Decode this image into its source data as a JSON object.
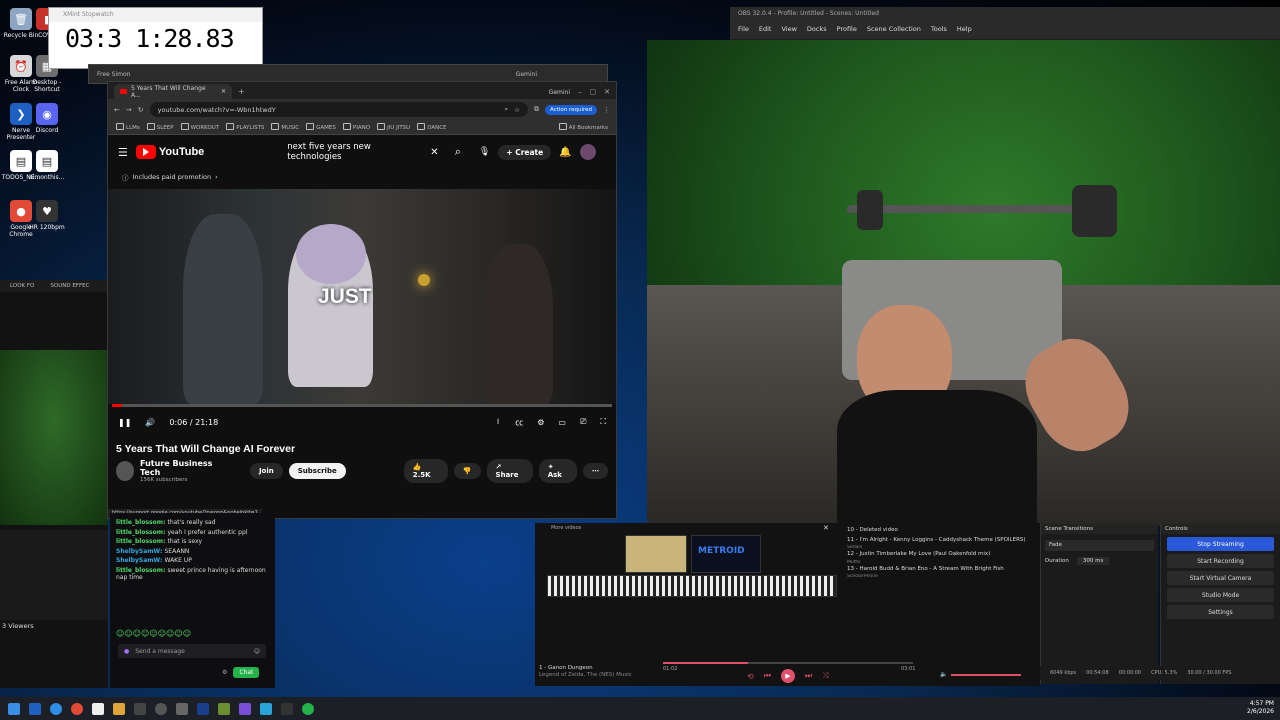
{
  "desktop": {
    "icons": [
      {
        "label": "Recycle Bin",
        "color": "#8da6c4",
        "glyph": "🗑"
      },
      {
        "label": "Free Alarm Clock",
        "color": "#d9d9d9",
        "glyph": "⏰"
      },
      {
        "label": "Nerve Presenter",
        "color": "#1e5fc2",
        "glyph": "❯"
      },
      {
        "label": "TODOS_NE...",
        "color": "#ffffff",
        "glyph": "▤"
      },
      {
        "label": "Google Chrome",
        "color": "#e04a36",
        "glyph": "●"
      },
      {
        "label": "COV...",
        "color": "#c8302a",
        "glyph": "▮"
      },
      {
        "label": "Desktop - Shortcut",
        "color": "#6e6e6e",
        "glyph": "▦"
      },
      {
        "label": "Discord",
        "color": "#5865f2",
        "glyph": "◉"
      },
      {
        "label": "simonthis...",
        "color": "#ffffff",
        "glyph": "▤"
      },
      {
        "label": "HR 120bpm",
        "color": "#333333",
        "glyph": "♥"
      }
    ]
  },
  "stopwatch": {
    "title": "XMint Stopwatch",
    "display": "03:3 1:28.83"
  },
  "chrome_back": {
    "tab": "Free Simon",
    "gemini": "Gemini"
  },
  "chrome": {
    "tab_title": "5 Years That Will Change A...",
    "gemini": "Gemini",
    "url": "youtube.com/watch?v=-Wbn1htwdY",
    "action_required": "Action required",
    "bookmarks": [
      "LLMs",
      "SLEEP",
      "WORKOUT",
      "PLAYLISTS",
      "MUSIC",
      "GAMES",
      "PIANO",
      "JIU JITSU",
      "DANCE"
    ],
    "all_bookmarks": "All Bookmarks",
    "status_url": "https://support.google.com/youtube/?p=ppp&nohelpkit=1"
  },
  "youtube": {
    "search_query": "next five years new technologies",
    "create_label": "Create",
    "promo": "Includes paid promotion",
    "caption": "JUST",
    "time_current": "0:06",
    "time_total": "21:18",
    "progress": 0.005,
    "video_title": "5 Years That Will Change AI Forever",
    "channel": "Future Business Tech",
    "subscribers": "156K subscribers",
    "join_label": "Join",
    "subscribe_label": "Subscribe",
    "likes": "2.5K",
    "share_label": "Share",
    "ask_label": "Ask"
  },
  "chat": {
    "messages": [
      {
        "user": "little_blossom:",
        "text": "that's really sad",
        "color": "#53d86a"
      },
      {
        "user": "little_blossom:",
        "text": "yeah I prefer authentic ppl",
        "color": "#53d86a"
      },
      {
        "user": "little_blossom:",
        "text": "that is sexy",
        "color": "#53d86a"
      },
      {
        "user": "ShelbySamW:",
        "text": "SEAANN",
        "color": "#2fa8e0"
      },
      {
        "user": "ShelbySamW:",
        "text": "WAKE UP",
        "color": "#2fa8e0"
      },
      {
        "user": "little_blossom:",
        "text": "sweet prince having is afternoon nap time",
        "color": "#53d86a"
      }
    ],
    "placeholder": "Send a message",
    "chat_button": "Chat",
    "viewers": "3 Viewers"
  },
  "leftstrip": {
    "items": [
      "LOOK FO",
      "SOUND EFFEC"
    ]
  },
  "obs": {
    "title": "OBS 32.0.4 - Profile: Untitled - Scenes: Untitled",
    "menu": [
      "File",
      "Edit",
      "View",
      "Docks",
      "Profile",
      "Scene Collection",
      "Tools",
      "Help"
    ],
    "scene_transitions": "Scene Transitions",
    "transition": "Fade",
    "duration_label": "Duration",
    "duration": "300 ms",
    "controls_label": "Controls",
    "buttons": [
      "Stop Streaming",
      "Start Recording",
      "Start Virtual Camera",
      "Studio Mode",
      "Settings"
    ],
    "status": [
      "6049 kbps",
      "00:54:08",
      "00:00:00",
      "CPU: 5.3%",
      "30.00 / 30.00 FPS"
    ]
  },
  "player": {
    "more_videos": "More videos",
    "playlist": [
      {
        "title": "10 - Deleted video",
        "sub": ""
      },
      {
        "title": "11 - I'm Alright - Kenny Loggins - Caddyshack Theme (SPOILERS)",
        "sub": "Sefalin"
      },
      {
        "title": "12 - Justin Timberlake My Love (Paul Oakenfold mix)",
        "sub": "Muffis"
      },
      {
        "title": "13 - Harold Budd & Brian Eno - A Stream With Bright Fish",
        "sub": "ScholarPhone"
      }
    ],
    "now_playing": "1 - Ganon Dungeon",
    "now_album": "Legend of Zelda, The (NES) Music",
    "time_current": "01:02",
    "time_total": "03:01",
    "progress": 0.34,
    "metroid_label": "METROID"
  },
  "taskbar": {
    "time": "4:57 PM",
    "date": "2/6/2026"
  }
}
